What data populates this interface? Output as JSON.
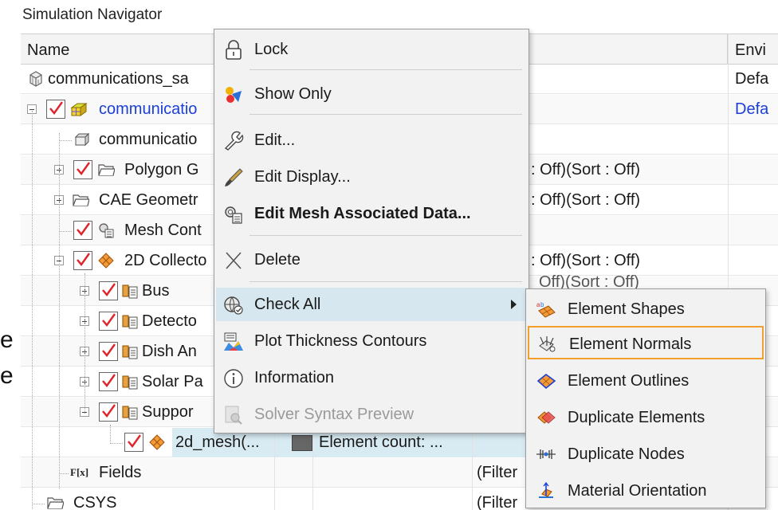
{
  "window_title": "Simulation Navigator",
  "columns": {
    "name": "Name",
    "env": "Envi"
  },
  "rows": [
    {
      "name": "communications_sa",
      "env": "Defa",
      "col3": ""
    },
    {
      "name": "communicatio",
      "env": "Defa",
      "col3": ""
    },
    {
      "name": "communicatio",
      "env": "",
      "col3": ""
    },
    {
      "name": "Polygon G",
      "env": "",
      "col3": ": Off)(Sort : Off)"
    },
    {
      "name": "CAE Geometr",
      "env": "",
      "col3": ": Off)(Sort : Off)"
    },
    {
      "name": "Mesh Cont",
      "env": "",
      "col3": ""
    },
    {
      "name": "2D Collecto",
      "env": "",
      "col3": ": Off)(Sort : Off)"
    },
    {
      "name": "Bus",
      "env": "",
      "col3": "Off)(Sort : Off)"
    },
    {
      "name": "Detecto",
      "env": "",
      "col3": ""
    },
    {
      "name": "Dish An",
      "env": "",
      "col3": ""
    },
    {
      "name": "Solar Pa",
      "env": "",
      "col3": ""
    },
    {
      "name": "Suppor",
      "env": "",
      "col3": ""
    },
    {
      "name": "2d_mesh(...",
      "env": "",
      "col3": "Element count: ..."
    },
    {
      "name": "Fields",
      "env": "",
      "col3": "(Filter"
    },
    {
      "name": "CSYS",
      "env": "",
      "col3": "(Filter"
    }
  ],
  "fields_icon_text": "F[x]",
  "bg_fragments": [
    "e",
    "e"
  ],
  "context_menu": [
    {
      "label": "Lock",
      "icon": "lock-icon"
    },
    {
      "label": "Show Only",
      "icon": "show-only-icon"
    },
    {
      "label": "Edit...",
      "icon": "wrench-icon"
    },
    {
      "label": "Edit Display...",
      "icon": "paintbrush-icon"
    },
    {
      "label": "Edit Mesh Associated Data...",
      "icon": "mesh-data-icon"
    },
    {
      "label": "Delete",
      "icon": "delete-x-icon"
    },
    {
      "label": "Check All",
      "icon": "check-all-icon"
    },
    {
      "label": "Plot Thickness Contours",
      "icon": "thickness-contour-icon"
    },
    {
      "label": "Information",
      "icon": "info-icon"
    },
    {
      "label": "Solver Syntax Preview",
      "icon": "solver-syntax-icon"
    }
  ],
  "check_all_submenu": [
    {
      "label": "Element Shapes",
      "icon": "element-shapes-icon"
    },
    {
      "label": "Element Normals",
      "icon": "element-normals-icon"
    },
    {
      "label": "Element Outlines",
      "icon": "element-outlines-icon"
    },
    {
      "label": "Duplicate Elements",
      "icon": "duplicate-elements-icon"
    },
    {
      "label": "Duplicate Nodes",
      "icon": "duplicate-nodes-icon"
    },
    {
      "label": "Material Orientation",
      "icon": "material-orientation-icon"
    }
  ],
  "colors": {
    "accent_blue": "#1a3fd6",
    "check_red": "#e0232b",
    "highlight": "#d7e7ef",
    "focus_orange": "#f2a02b"
  }
}
